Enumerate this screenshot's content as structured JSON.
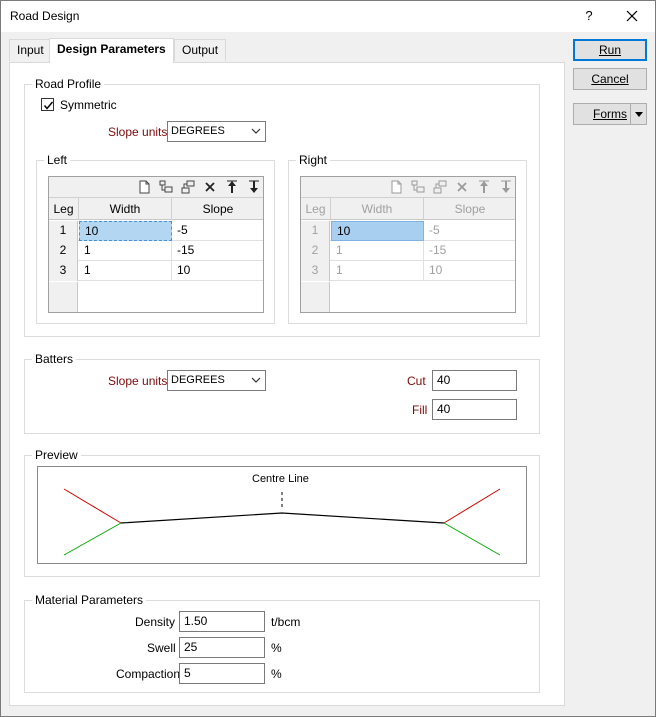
{
  "window": {
    "title": "Road Design",
    "help": "?"
  },
  "tabs": [
    {
      "label": "Input",
      "active": false
    },
    {
      "label": "Design Parameters",
      "active": true
    },
    {
      "label": "Output",
      "active": false
    }
  ],
  "buttons": {
    "run": "Run",
    "cancel": "Cancel",
    "forms": "Forms"
  },
  "road_profile": {
    "title": "Road Profile",
    "symmetric_label": "Symmetric",
    "symmetric_checked": true,
    "slope_units_label": "Slope units",
    "slope_units_value": "DEGREES"
  },
  "left": {
    "title": "Left",
    "headers": {
      "leg": "Leg",
      "width": "Width",
      "slope": "Slope"
    },
    "rows": [
      {
        "leg": "1",
        "width": "10",
        "slope": "-5"
      },
      {
        "leg": "2",
        "width": "1",
        "slope": "-15"
      },
      {
        "leg": "3",
        "width": "1",
        "slope": "10"
      }
    ]
  },
  "right": {
    "title": "Right",
    "headers": {
      "leg": "Leg",
      "width": "Width",
      "slope": "Slope"
    },
    "rows": [
      {
        "leg": "1",
        "width": "10",
        "slope": "-5"
      },
      {
        "leg": "2",
        "width": "1",
        "slope": "-15"
      },
      {
        "leg": "3",
        "width": "1",
        "slope": "10"
      }
    ]
  },
  "batters": {
    "title": "Batters",
    "slope_units_label": "Slope units",
    "slope_units_value": "DEGREES",
    "cut_label": "Cut",
    "cut_value": "40",
    "fill_label": "Fill",
    "fill_value": "40"
  },
  "preview": {
    "title": "Preview",
    "centre_line_label": "Centre Line",
    "colors": {
      "road": "#000000",
      "cut": "#cc0000",
      "fill": "#00aa00"
    }
  },
  "material": {
    "title": "Material Parameters",
    "density_label": "Density",
    "density_value": "1.50",
    "density_unit": "t/bcm",
    "swell_label": "Swell",
    "swell_value": "25",
    "swell_unit": "%",
    "compaction_label": "Compaction",
    "compaction_value": "5",
    "compaction_unit": "%"
  }
}
